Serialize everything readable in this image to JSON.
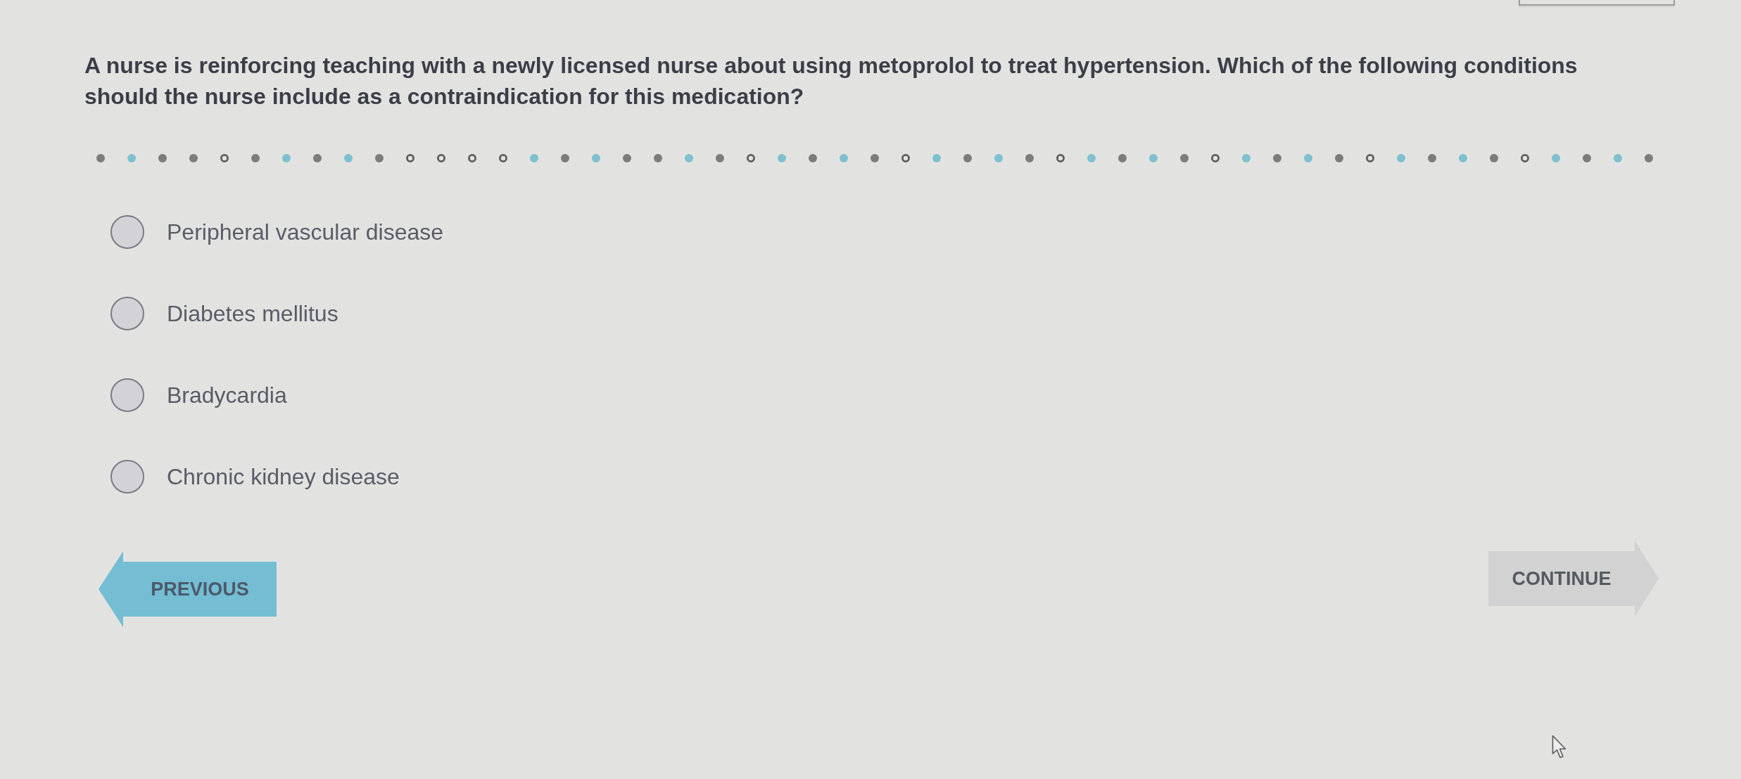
{
  "question": "A nurse is reinforcing teaching with a newly licensed nurse about using metoprolol to treat hypertension. Which of the following conditions should the nurse include as a contraindication for this medication?",
  "divider_dots": [
    {
      "kind": "filled",
      "color": "#7c7c7c"
    },
    {
      "kind": "filled",
      "color": "#7fc0cf"
    },
    {
      "kind": "filled",
      "color": "#7c7c7c"
    },
    {
      "kind": "filled",
      "color": "#7c7c7c"
    },
    {
      "kind": "ring",
      "color": "#5c5c5c"
    },
    {
      "kind": "filled",
      "color": "#7c7c7c"
    },
    {
      "kind": "filled",
      "color": "#7fc0cf"
    },
    {
      "kind": "filled",
      "color": "#7c7c7c"
    },
    {
      "kind": "filled",
      "color": "#7fc0cf"
    },
    {
      "kind": "filled",
      "color": "#7c7c7c"
    },
    {
      "kind": "ring",
      "color": "#5c5c5c"
    },
    {
      "kind": "ring",
      "color": "#5c5c5c"
    },
    {
      "kind": "ring",
      "color": "#5c5c5c"
    },
    {
      "kind": "ring",
      "color": "#5c5c5c"
    },
    {
      "kind": "filled",
      "color": "#7fc0cf"
    },
    {
      "kind": "filled",
      "color": "#7c7c7c"
    },
    {
      "kind": "filled",
      "color": "#7fc0cf"
    },
    {
      "kind": "filled",
      "color": "#7c7c7c"
    },
    {
      "kind": "filled",
      "color": "#7c7c7c"
    },
    {
      "kind": "filled",
      "color": "#7fc0cf"
    },
    {
      "kind": "filled",
      "color": "#7c7c7c"
    },
    {
      "kind": "ring",
      "color": "#5c5c5c"
    },
    {
      "kind": "filled",
      "color": "#7fc0cf"
    },
    {
      "kind": "filled",
      "color": "#7c7c7c"
    },
    {
      "kind": "filled",
      "color": "#7fc0cf"
    },
    {
      "kind": "filled",
      "color": "#7c7c7c"
    },
    {
      "kind": "ring",
      "color": "#5c5c5c"
    },
    {
      "kind": "filled",
      "color": "#7fc0cf"
    },
    {
      "kind": "filled",
      "color": "#7c7c7c"
    },
    {
      "kind": "filled",
      "color": "#7fc0cf"
    },
    {
      "kind": "filled",
      "color": "#7c7c7c"
    },
    {
      "kind": "ring",
      "color": "#5c5c5c"
    },
    {
      "kind": "filled",
      "color": "#7fc0cf"
    },
    {
      "kind": "filled",
      "color": "#7c7c7c"
    },
    {
      "kind": "filled",
      "color": "#7fc0cf"
    },
    {
      "kind": "filled",
      "color": "#7c7c7c"
    },
    {
      "kind": "ring",
      "color": "#5c5c5c"
    },
    {
      "kind": "filled",
      "color": "#7fc0cf"
    },
    {
      "kind": "filled",
      "color": "#7c7c7c"
    },
    {
      "kind": "filled",
      "color": "#7fc0cf"
    },
    {
      "kind": "filled",
      "color": "#7c7c7c"
    },
    {
      "kind": "ring",
      "color": "#5c5c5c"
    },
    {
      "kind": "filled",
      "color": "#7fc0cf"
    },
    {
      "kind": "filled",
      "color": "#7c7c7c"
    },
    {
      "kind": "filled",
      "color": "#7fc0cf"
    },
    {
      "kind": "filled",
      "color": "#7c7c7c"
    },
    {
      "kind": "ring",
      "color": "#5c5c5c"
    },
    {
      "kind": "filled",
      "color": "#7fc0cf"
    },
    {
      "kind": "filled",
      "color": "#7c7c7c"
    },
    {
      "kind": "filled",
      "color": "#7fc0cf"
    },
    {
      "kind": "filled",
      "color": "#7c7c7c"
    }
  ],
  "options": [
    {
      "label": "Peripheral vascular disease",
      "selected": false
    },
    {
      "label": "Diabetes mellitus",
      "selected": false
    },
    {
      "label": "Bradycardia",
      "selected": false
    },
    {
      "label": "Chronic kidney disease",
      "selected": false
    }
  ],
  "buttons": [
    {
      "label": "PREVIOUS",
      "kind": "back",
      "disabled": false
    },
    {
      "label": "CONTINUE",
      "kind": "forward",
      "disabled": true
    }
  ]
}
